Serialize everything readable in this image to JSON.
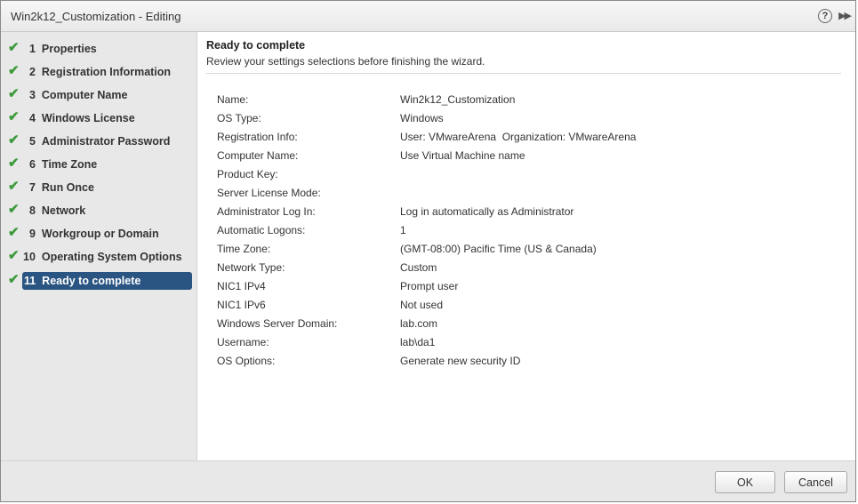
{
  "window": {
    "title": "Win2k12_Customization - Editing"
  },
  "steps": [
    {
      "num": "1",
      "label": "Properties"
    },
    {
      "num": "2",
      "label": "Registration Information"
    },
    {
      "num": "3",
      "label": "Computer Name"
    },
    {
      "num": "4",
      "label": "Windows License"
    },
    {
      "num": "5",
      "label": "Administrator Password"
    },
    {
      "num": "6",
      "label": "Time Zone"
    },
    {
      "num": "7",
      "label": "Run Once"
    },
    {
      "num": "8",
      "label": "Network"
    },
    {
      "num": "9",
      "label": "Workgroup or Domain"
    },
    {
      "num": "10",
      "label": "Operating System Options"
    },
    {
      "num": "11",
      "label": "Ready to complete"
    }
  ],
  "content": {
    "title": "Ready to complete",
    "subtitle": "Review your settings selections before finishing the wizard.",
    "summary": [
      {
        "key": "Name:",
        "value": "Win2k12_Customization"
      },
      {
        "key": "OS Type:",
        "value": "Windows"
      },
      {
        "key": "Registration Info:",
        "value": "User: VMwareArena  Organization: VMwareArena"
      },
      {
        "key": "Computer Name:",
        "value": "Use Virtual Machine name"
      },
      {
        "key": "Product Key:",
        "value": ""
      },
      {
        "key": "Server License Mode:",
        "value": ""
      },
      {
        "key": "Administrator Log In:",
        "value": "Log in automatically as Administrator"
      },
      {
        "key": "Automatic Logons:",
        "value": "1"
      },
      {
        "key": "Time Zone:",
        "value": "(GMT-08:00) Pacific Time (US & Canada)"
      },
      {
        "key": "Network Type:",
        "value": "Custom"
      },
      {
        "key": "NIC1 IPv4",
        "value": "Prompt user"
      },
      {
        "key": "NIC1 IPv6",
        "value": "Not used"
      },
      {
        "key": "Windows Server Domain:",
        "value": "lab.com"
      },
      {
        "key": "Username:",
        "value": "lab\\da1"
      },
      {
        "key": "OS Options:",
        "value": "Generate new security ID"
      }
    ]
  },
  "footer": {
    "ok_label": "OK",
    "cancel_label": "Cancel"
  },
  "icons": {
    "help": "?",
    "expand": "▶▶",
    "check": "✔"
  }
}
